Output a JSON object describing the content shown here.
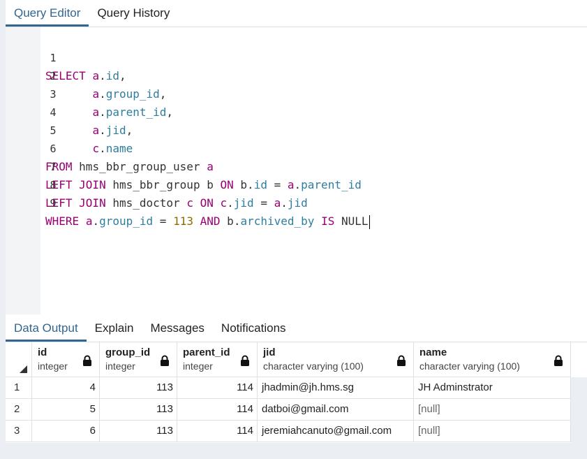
{
  "top_tabs": [
    {
      "label": "Query Editor",
      "active": true
    },
    {
      "label": "Query History",
      "active": false
    }
  ],
  "line_numbers": [
    "1",
    "2",
    "3",
    "4",
    "5",
    "6",
    "7",
    "8",
    "9"
  ],
  "bottom_tabs": [
    {
      "label": "Data Output",
      "active": true
    },
    {
      "label": "Explain",
      "active": false
    },
    {
      "label": "Messages",
      "active": false
    },
    {
      "label": "Notifications",
      "active": false
    }
  ],
  "grid": {
    "columns": [
      {
        "name": "id",
        "type": "integer"
      },
      {
        "name": "group_id",
        "type": "integer"
      },
      {
        "name": "parent_id",
        "type": "integer"
      },
      {
        "name": "jid",
        "type": "character varying (100)"
      },
      {
        "name": "name",
        "type": "character varying (100)"
      }
    ],
    "rows": [
      {
        "n": "1",
        "id": "4",
        "group_id": "113",
        "parent_id": "114",
        "jid": "jhadmin@jh.hms.sg",
        "name": "JH Adminstrator"
      },
      {
        "n": "2",
        "id": "5",
        "group_id": "113",
        "parent_id": "114",
        "jid": "datboi@gmail.com",
        "name": "[null]"
      },
      {
        "n": "3",
        "id": "6",
        "group_id": "113",
        "parent_id": "114",
        "jid": "jeremiahcanuto@gmail.com",
        "name": "[null]"
      }
    ]
  },
  "sql": {
    "l1": {
      "kw": "SELECT",
      "a": "a",
      "c": "id",
      "comma": ","
    },
    "l2": {
      "a": "a",
      "c": "group_id",
      "comma": ","
    },
    "l3": {
      "a": "a",
      "c": "parent_id",
      "comma": ","
    },
    "l4": {
      "a": "a",
      "c": "jid",
      "comma": ","
    },
    "l5": {
      "a": "c",
      "c": "name"
    },
    "l6": {
      "kw": "FROM",
      "t": "hms_bbr_group_user",
      "al": "a"
    },
    "l7": {
      "kw": "LEFT JOIN",
      "t": "hms_bbr_group",
      "al": "b",
      "on": "ON",
      "b": "b",
      "c1": "id",
      "eq": "=",
      "a": "a",
      "c2": "parent_id"
    },
    "l8": {
      "kw": "LEFT JOIN",
      "t": "hms_doctor",
      "al": "c",
      "on": "ON",
      "c": "c",
      "c1": "jid",
      "eq": "=",
      "a": "a",
      "c2": "jid"
    },
    "l9": {
      "kw": "WHERE",
      "a": "a",
      "c1": "group_id",
      "eq": "=",
      "num": "113",
      "and": "AND",
      "b": "b",
      "c2": "archived_by",
      "is": "IS",
      "null": "NULL"
    }
  },
  "colors": {
    "accent": "#326690",
    "keyword": "#990073",
    "column": "#2d7ea0",
    "number": "#8a6d00"
  }
}
